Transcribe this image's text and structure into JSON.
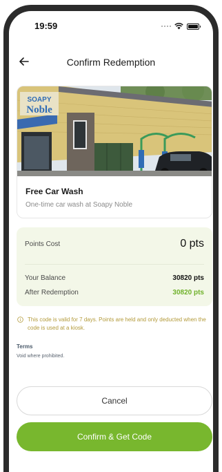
{
  "status_bar": {
    "time": "19:59",
    "icons": [
      "signal-dots-icon",
      "wifi-icon",
      "battery-icon"
    ]
  },
  "header": {
    "back_icon": "arrow-left-icon",
    "title": "Confirm Redemption"
  },
  "offer": {
    "image_sign_text": "Soapy Noble",
    "title": "Free Car Wash",
    "subtitle": "One-time car wash at Soapy Noble"
  },
  "points": {
    "cost_label": "Points Cost",
    "cost_value": "0 pts",
    "balance_label": "Your Balance",
    "balance_value": "30820 pts",
    "after_label": "After Redemption",
    "after_value": "30820 pts"
  },
  "notice": {
    "icon": "info-circle-icon",
    "text": "This code is valid for 7 days. Points are held and only deducted when the code is used at a kiosk."
  },
  "terms": {
    "label": "Terms",
    "body": "Void where prohibited."
  },
  "actions": {
    "cancel_label": "Cancel",
    "confirm_label": "Confirm & Get Code"
  },
  "colors": {
    "accent": "#78b72e",
    "after_value": "#6fb12a",
    "points_bg": "#f3f7e8",
    "notice_text": "#b39a3a"
  }
}
